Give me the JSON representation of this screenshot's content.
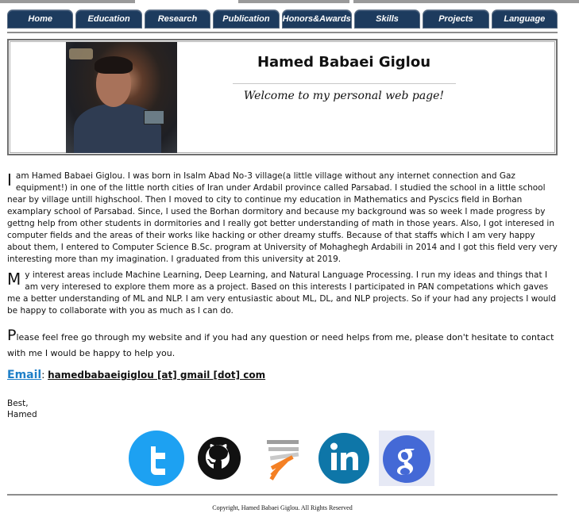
{
  "nav": {
    "items": [
      {
        "label": "Home"
      },
      {
        "label": "Education"
      },
      {
        "label": "Research"
      },
      {
        "label": "Publication"
      },
      {
        "label": "Honors&Awards"
      },
      {
        "label": "Skills"
      },
      {
        "label": "Projects"
      },
      {
        "label": "Language"
      }
    ]
  },
  "header": {
    "name": "Hamed Babaei Giglou",
    "welcome": "Welcome to my personal web page!"
  },
  "bio": {
    "p1_cap": "I",
    "p1": "am Hamed Babaei Giglou. I was born in Isalm Abad No-3 village(a little village without any internet connection and Gaz equipment!) in one of the little north cities of Iran under Ardabil province called Parsabad. I studied the school in a little school near by village untill highschool. Then I moved to city to continue my education in Mathematics and Pyscics field in Borhan examplary school of Parsabad. Since, I used the Borhan dormitory and because my background was so week I made progress by gettng help from other students in dormitories and I really got better understanding of math in those years. Also, I got interesed in computer fields and the areas of their works like hacking or other dreamy stuffs. Because of that staffs which I am very happy about them, I entered to Computer Science B.Sc. program at University of Mohaghegh Ardabili in 2014 and I got this field very very interesting more than my imagination. I graduated from this university at 2019.",
    "p2_cap": "M",
    "p2": "y interest areas include Machine Learning, Deep Learning, and Natural Language Processing. I run my ideas and things that I am very interesed to explore them more as a project. Based on this interests I participated in PAN competations which gaves me a better understanding of ML and NLP. I am very entusiastic about ML, DL, and NLP projects. So if your had any projects I would be happy to collaborate with you as much as I can do.",
    "p3_cap": "P",
    "p3": "lease feel free go through my website and if you had any question or need helps from me, please don't hesitate to contact with me I would be happy to help you."
  },
  "contact": {
    "email_label": "Email",
    "separator": ":",
    "email_value": "hamedbabaeigiglou [at] gmail [dot] com"
  },
  "signoff": {
    "line1": "Best,",
    "line2": "Hamed"
  },
  "socials": [
    {
      "icon": "twitter-icon",
      "color": "#1da1f2"
    },
    {
      "icon": "github-icon",
      "color": "#111111"
    },
    {
      "icon": "stackoverflow-icon",
      "color": "#f48024"
    },
    {
      "icon": "linkedin-icon",
      "color": "#0e76a8"
    },
    {
      "icon": "google-scholar-icon",
      "color": "#4469d6"
    }
  ],
  "footer": {
    "copyright": "Copyright, Hamed Babaei Giglou. All Rights Reserved"
  }
}
